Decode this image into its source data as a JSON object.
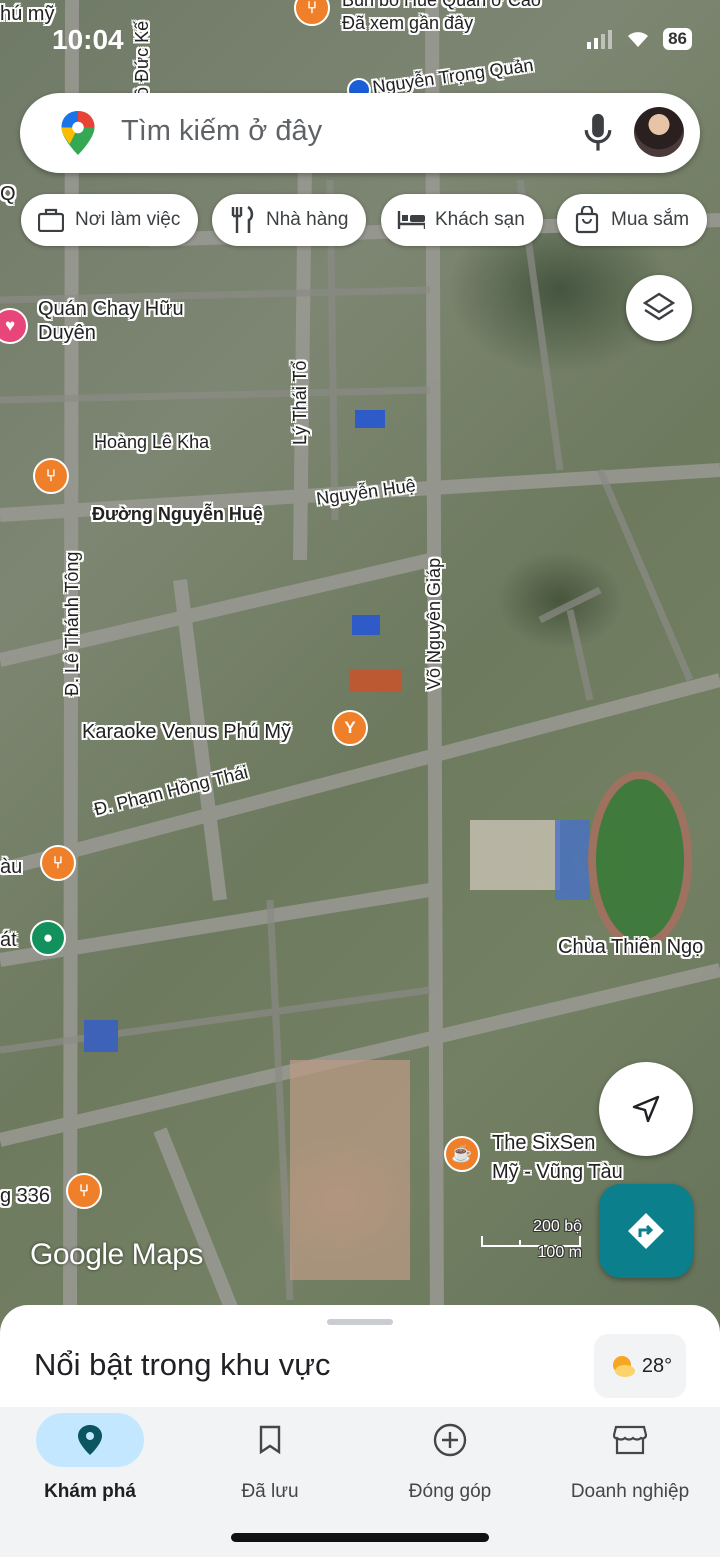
{
  "status_bar": {
    "time": "10:04",
    "battery": "86"
  },
  "search": {
    "placeholder": "Tìm kiếm ở đây"
  },
  "chips": [
    {
      "label": "Nơi làm việc",
      "icon": "briefcase-icon"
    },
    {
      "label": "Nhà hàng",
      "icon": "restaurant-icon"
    },
    {
      "label": "Khách sạn",
      "icon": "hotel-bed-icon"
    },
    {
      "label": "Mua sắm",
      "icon": "shopping-bag-icon"
    }
  ],
  "map": {
    "labels": {
      "phu_my": "hú mỹ",
      "recent_place": "Đã xem gần đây",
      "recent_place_top": "Bún bò Huế Quán ở Cao",
      "nguyen_trong_quan": "Nguyễn Trọng Quản",
      "ngo_duc_ke": "Ngô Đức Kế",
      "quan_chay": "Quán Chay Hữu Duyên",
      "hoang_le_kha": "Hoàng Lê Kha",
      "ly_thai_to": "Lý Thái Tổ",
      "nguyen_hue_short": "Nguyễn Huệ",
      "duong_nguyen_hue": "Đường Nguyễn Huệ",
      "le_thanh_tong": "Đ. Lê Thánh Tông",
      "vo_nguyen_giap": "Võ Nguyên Giáp",
      "karaoke": "Karaoke Venus Phú Mỹ",
      "pham_hong_thai": "Đ. Phạm Hồng Thái",
      "tau": "àu",
      "at": "át",
      "chua": "Chùa Thiên Ngọ",
      "sixsen_1": "The SixSen",
      "sixsen_2": "Mỹ - Vũng Tàu",
      "road_336": "g 336",
      "q": "Q"
    },
    "scale_top": "200 bộ",
    "scale_bottom": "100 m",
    "watermark": "Google Maps"
  },
  "sheet": {
    "title": "Nổi bật trong khu vực",
    "weather": "28°"
  },
  "nav": [
    {
      "label": "Khám phá",
      "icon": "explore-pin-icon",
      "active": true
    },
    {
      "label": "Đã lưu",
      "icon": "bookmark-icon",
      "active": false
    },
    {
      "label": "Đóng góp",
      "icon": "add-circle-icon",
      "active": false
    },
    {
      "label": "Doanh nghiệp",
      "icon": "storefront-icon",
      "active": false
    }
  ],
  "colors": {
    "accent": "#0b7f8c",
    "nav_active_bg": "#c2e7ff",
    "poi_orange": "#f07f2a",
    "poi_green": "#12915c"
  }
}
